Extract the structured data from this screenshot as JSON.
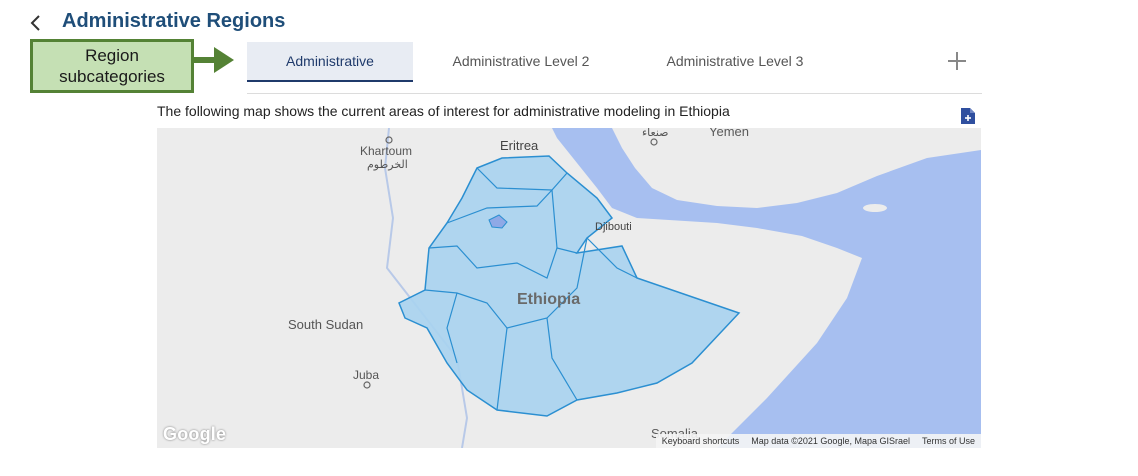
{
  "header": {
    "title": "Administrative Regions"
  },
  "callout": {
    "line1": "Region",
    "line2": "subcategories"
  },
  "tabs": [
    {
      "label": "Administrative",
      "active": true
    },
    {
      "label": "Administrative Level 2",
      "active": false
    },
    {
      "label": "Administrative Level 3",
      "active": false
    }
  ],
  "description": "The following map shows the current areas of interest for administrative modeling in Ethiopia",
  "map": {
    "labels": {
      "yemen": "Yemen",
      "sanaa": "صنعاء",
      "eritrea": "Eritrea",
      "khartoum": "Khartoum",
      "khartoum_ar": "الخرطوم",
      "djibouti": "Djibouti",
      "ethiopia": "Ethiopia",
      "south_sudan": "South Sudan",
      "juba": "Juba",
      "somalia": "Somalia"
    },
    "logo": "Google",
    "footer": {
      "shortcuts": "Keyboard shortcuts",
      "attribution": "Map data ©2021 Google, Mapa GISrael",
      "terms": "Terms of Use"
    },
    "colors": {
      "land": "#ececec",
      "water": "#a7bff0",
      "region_fill": "#a9d3ef",
      "region_stroke": "#2b8fd1"
    }
  },
  "colors": {
    "title": "#1f4e79",
    "callout_bg": "#c5e0b4",
    "callout_border": "#548235",
    "tab_active": "#1f3a6b"
  },
  "icons": {
    "back": "chevron-left-icon",
    "add": "plus-icon",
    "export": "file-add-icon"
  }
}
